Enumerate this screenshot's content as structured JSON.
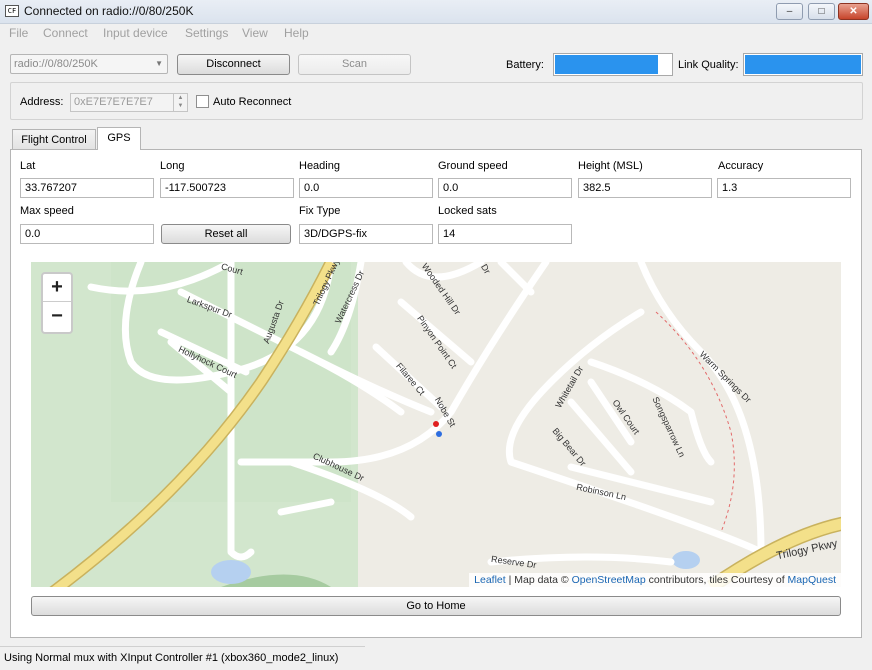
{
  "window": {
    "title": "Connected on radio://0/80/250K",
    "app_icon": "app-icon",
    "controls": {
      "minimize": "–",
      "maximize": "□",
      "close": "✕"
    }
  },
  "menu": [
    "File",
    "Connect",
    "Input device",
    "Settings",
    "View",
    "Help"
  ],
  "toolbar": {
    "radio_select": "radio://0/80/250K",
    "disconnect_label": "Disconnect",
    "scan_label": "Scan",
    "battery_label": "Battery:",
    "battery_level": 0.89,
    "link_quality_label": "Link Quality:",
    "link_quality_level": 1.0,
    "accent": "#2a93ee"
  },
  "address": {
    "label": "Address:",
    "value": "0xE7E7E7E7E7",
    "auto_reconnect_label": "Auto Reconnect",
    "auto_reconnect_checked": false
  },
  "tabs": [
    {
      "label": "Flight Control",
      "active": false
    },
    {
      "label": "GPS",
      "active": true
    }
  ],
  "gps": {
    "lat_label": "Lat",
    "lat": "33.767207",
    "long_label": "Long",
    "long": "-117.500723",
    "heading_label": "Heading",
    "heading": "0.0",
    "ground_speed_label": "Ground speed",
    "ground_speed": "0.0",
    "height_label": "Height (MSL)",
    "height": "382.5",
    "accuracy_label": "Accuracy",
    "accuracy": "1.3",
    "max_speed_label": "Max speed",
    "max_speed": "0.0",
    "reset_all_label": "Reset all",
    "fix_type_label": "Fix Type",
    "fix_type": "3D/DGPS-fix",
    "locked_sats_label": "Locked sats",
    "locked_sats": "14"
  },
  "map": {
    "zoom_in": "+",
    "zoom_out": "−",
    "attribution": {
      "leaflet": "Leaflet",
      "sep": " | Map data © ",
      "osm": "OpenStreetMap",
      "mid": " contributors, tiles Courtesy of ",
      "mapquest": "MapQuest"
    },
    "streets": [
      "Trilogy Pkwy",
      "Larkspur Dr",
      "Augusta Dr",
      "Hollyhock Court",
      "Watercress Dr",
      "Wooded Hill Dr",
      "Pinyon Point Ct",
      "Filaree Ct",
      "Nobe St",
      "Clubhouse Dr",
      "Whitetail Dr",
      "Owl Court",
      "Songsparrow Ln",
      "Big Bear Dr",
      "Warm Springs Dr",
      "Robinson Ln",
      "Reserve Dr",
      "Trilogy Pkwy",
      "Court",
      "Dr"
    ]
  },
  "go_home_label": "Go to Home",
  "status": "Using Normal mux with XInput Controller #1 (xbox360_mode2_linux)"
}
